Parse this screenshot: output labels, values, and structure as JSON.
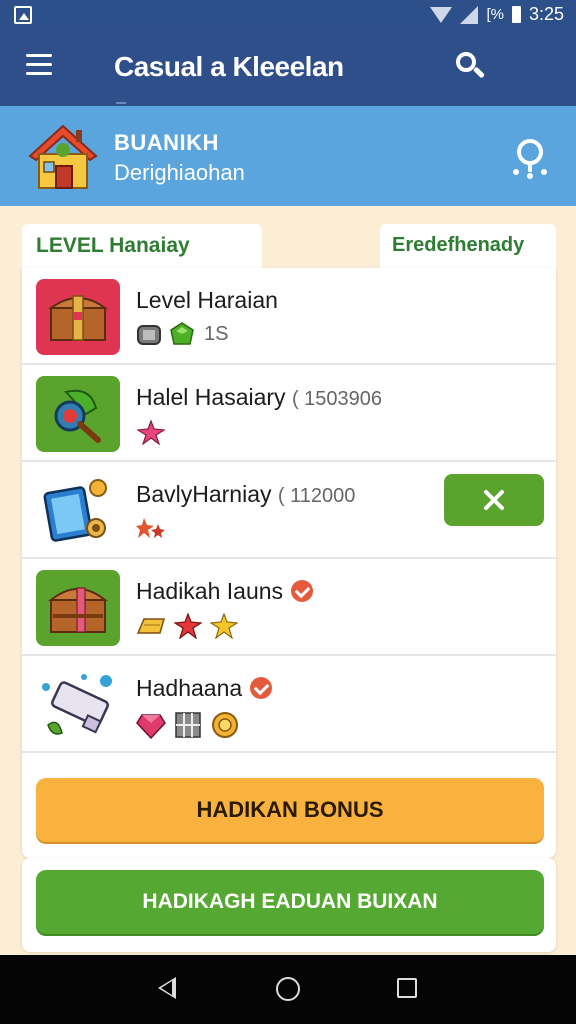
{
  "status_bar": {
    "battery_label": "[%",
    "time": "3:25"
  },
  "app_bar": {
    "title": "Casual a Kleeelan"
  },
  "banner": {
    "title": "BUANIKH",
    "subtitle": "Derighiaohan"
  },
  "tabs": {
    "left": "LEVEL Hanaiay",
    "right": "Eredefhenady"
  },
  "list": [
    {
      "title": "Level Haraian",
      "number": "",
      "badge_count": "1S",
      "icon": "treasure-chest-icon",
      "badges": [
        "stone-icon",
        "green-gem-icon"
      ]
    },
    {
      "title": "Halel Hasaiary",
      "number": "( 1503906",
      "badge_count": "",
      "icon": "magnifier-potion-icon",
      "badges": [
        "pink-star-icon"
      ]
    },
    {
      "title": "BavlyHarniay",
      "number": "( 112000",
      "badge_count": "",
      "icon": "tablet-device-icon",
      "badges": [
        "orange-sparkle-icon"
      ],
      "action": "close"
    },
    {
      "title": "Hadikah Iauns",
      "number": "",
      "badge_count": "",
      "icon": "treasure-chest-icon",
      "badges": [
        "gold-bar-icon",
        "red-star-icon",
        "yellow-star-icon"
      ],
      "verified": true
    },
    {
      "title": "Hadhaana",
      "number": "",
      "badge_count": "",
      "icon": "paint-tube-icon",
      "badges": [
        "pink-gem-icon",
        "grid-block-icon",
        "gold-medal-icon"
      ],
      "verified": true
    }
  ],
  "buttons": {
    "bonus": "HADIKAN BONUS",
    "green": "HADIKAGH EADUAN BUIXAN"
  },
  "colors": {
    "appbar": "#2f4f8b",
    "banner": "#5aa5de",
    "accent_orange": "#f9b23d",
    "accent_green": "#55a831",
    "tab_text": "#2e7d32"
  }
}
